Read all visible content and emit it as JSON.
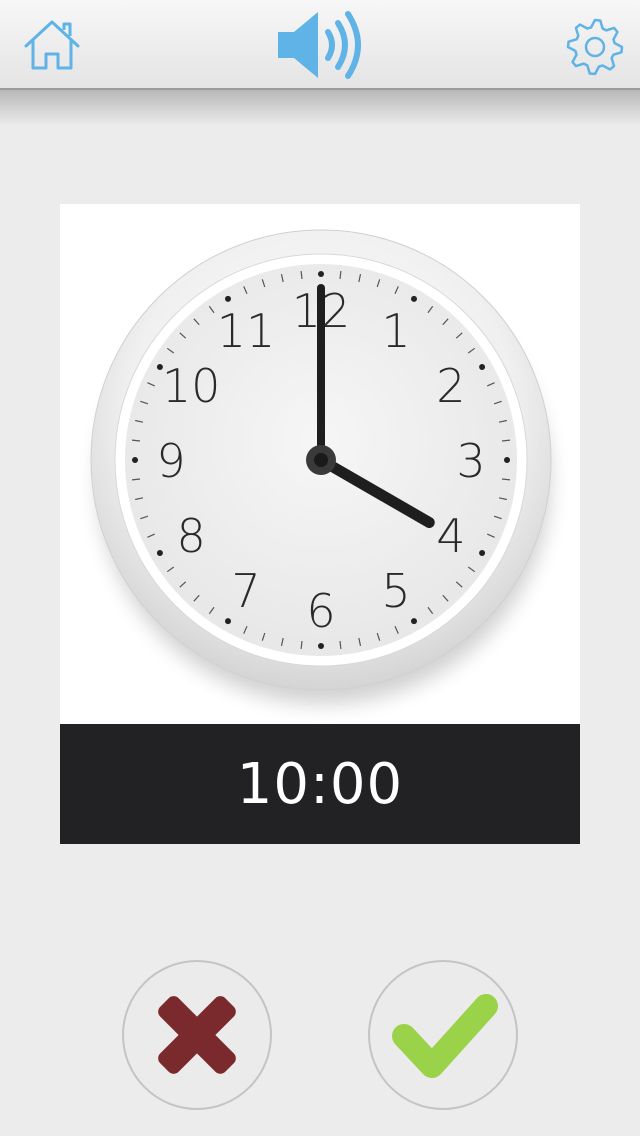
{
  "header": {
    "home_icon": "home-icon",
    "sound_icon": "speaker-volume-icon",
    "settings_icon": "gear-icon",
    "accent_color": "#5fb3e6"
  },
  "clock": {
    "numerals": [
      "12",
      "1",
      "2",
      "3",
      "4",
      "5",
      "6",
      "7",
      "8",
      "9",
      "10",
      "11"
    ],
    "hour_hand_hour": 4,
    "minute_hand_minute": 0
  },
  "answer": {
    "time_label": "10:00"
  },
  "actions": {
    "wrong_icon": "cross-icon",
    "wrong_color": "#7a2a2c",
    "correct_icon": "checkmark-icon",
    "correct_color": "#9ad24a"
  }
}
